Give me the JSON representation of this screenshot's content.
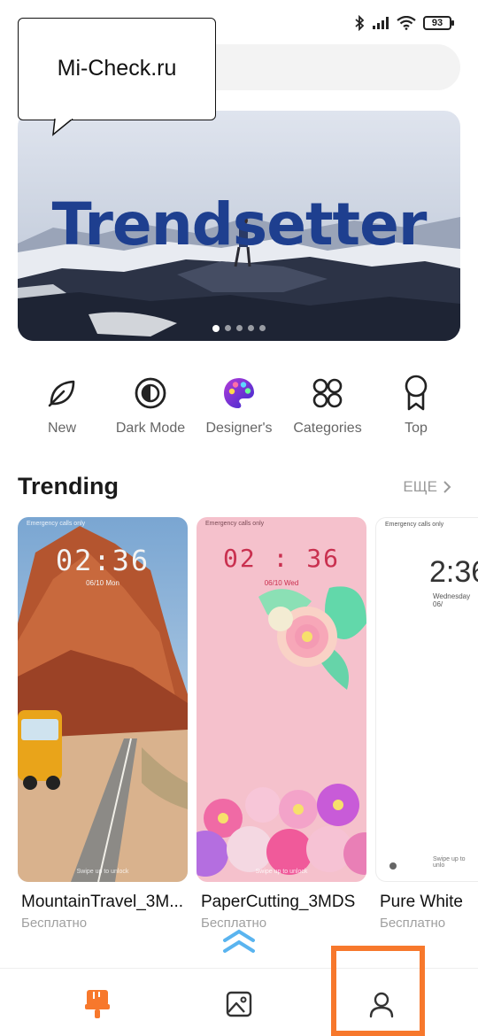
{
  "status": {
    "battery": "93"
  },
  "watermark": {
    "text": "Mi-Check.ru"
  },
  "banner": {
    "title": "Trendsetter",
    "page_count": 5,
    "active_page": 1
  },
  "categories": [
    {
      "label": "New",
      "icon": "leaf-icon"
    },
    {
      "label": "Dark Mode",
      "icon": "half-moon-icon"
    },
    {
      "label": "Designer's",
      "icon": "palette-icon"
    },
    {
      "label": "Categories",
      "icon": "grid-icon"
    },
    {
      "label": "Top",
      "icon": "ribbon-icon"
    }
  ],
  "trending": {
    "title": "Trending",
    "more_label": "ЕЩЕ",
    "cards": [
      {
        "name": "MountainTravel_3M...",
        "price": "Бесплатно",
        "lock_status": "Emergency calls only",
        "time": "02:36",
        "date": "06/10 Mon",
        "swipe": "Swipe up to unlock"
      },
      {
        "name": "PaperCutting_3MDS",
        "price": "Бесплатно",
        "lock_status": "Emergency calls only",
        "time": "02 : 36",
        "date": "06/10  Wed",
        "swipe": "Swipe up to unlock"
      },
      {
        "name": "Pure White",
        "price": "Бесплатно",
        "lock_status": "Emergency calls only",
        "time": "2:36",
        "date": "Wednesday 06/",
        "swipe": "Swipe up to unlo"
      }
    ]
  },
  "nav": {
    "items": [
      {
        "name": "themes",
        "icon": "brush-icon",
        "active": true
      },
      {
        "name": "wallpapers",
        "icon": "image-icon",
        "active": false
      },
      {
        "name": "profile",
        "icon": "person-icon",
        "active": false
      }
    ]
  },
  "colors": {
    "accent": "#f7782c",
    "banner_text": "#1e3f8f",
    "muted": "#9a9a9a"
  }
}
